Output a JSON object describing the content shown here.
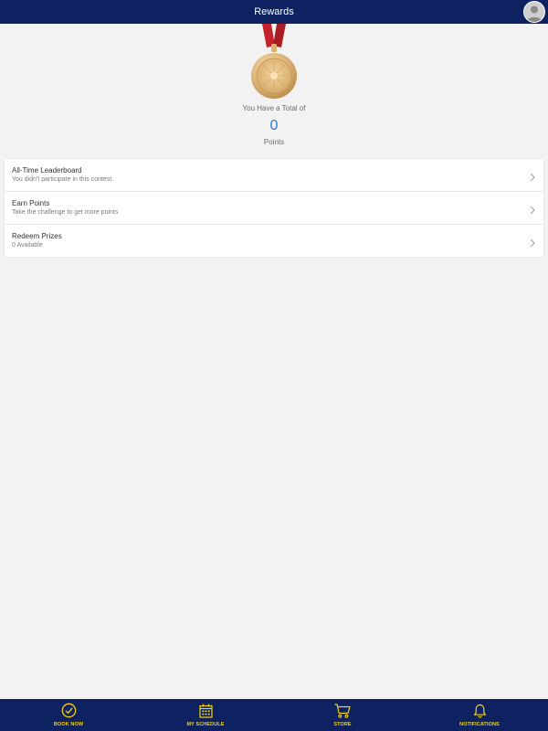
{
  "header": {
    "title": "Rewards",
    "avatar_icon": "user-avatar-icon"
  },
  "rewards": {
    "caption": "You Have a Total of",
    "points": "0",
    "unit": "Points"
  },
  "list": [
    {
      "label": "All-Time Leaderboard",
      "sub": "You didn't participate in this contest."
    },
    {
      "label": "Earn Points",
      "sub": "Take the challenge to get more points"
    },
    {
      "label": "Redeem Prizes",
      "sub": "0 Available"
    }
  ],
  "tabs": [
    {
      "label": "BOOK NOW",
      "icon": "check-circle-icon"
    },
    {
      "label": "MY SCHEDULE",
      "icon": "calendar-icon"
    },
    {
      "label": "STORE",
      "icon": "cart-icon"
    },
    {
      "label": "NOTIFICATIONS",
      "icon": "bell-icon"
    }
  ],
  "colors": {
    "bar": "#0e2161",
    "tab_label": "#f5d311",
    "points": "#2b7bd4",
    "background": "#f2f2f2"
  }
}
